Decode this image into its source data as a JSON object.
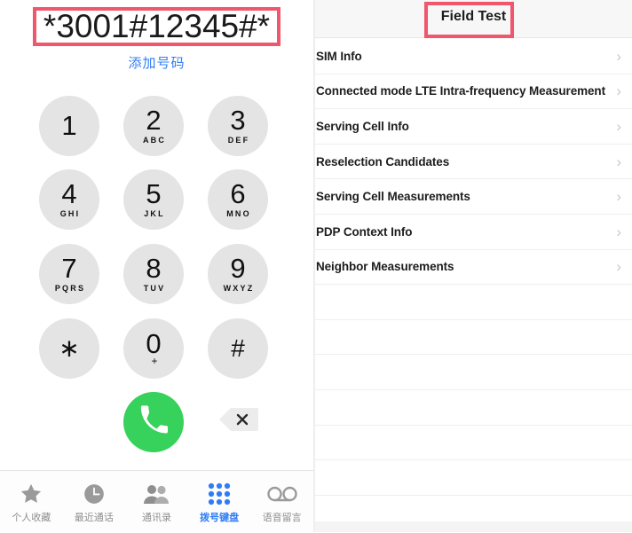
{
  "dialer": {
    "number": "*3001#12345#*",
    "add_number_label": "添加号码",
    "keys": [
      {
        "digit": "1",
        "letters": ""
      },
      {
        "digit": "2",
        "letters": "ABC"
      },
      {
        "digit": "3",
        "letters": "DEF"
      },
      {
        "digit": "4",
        "letters": "GHI"
      },
      {
        "digit": "5",
        "letters": "JKL"
      },
      {
        "digit": "6",
        "letters": "MNO"
      },
      {
        "digit": "7",
        "letters": "PQRS"
      },
      {
        "digit": "8",
        "letters": "TUV"
      },
      {
        "digit": "9",
        "letters": "WXYZ"
      },
      {
        "digit": "∗",
        "letters": ""
      },
      {
        "digit": "0",
        "letters": "+"
      },
      {
        "digit": "#",
        "letters": ""
      }
    ],
    "call_button_icon": "phone-icon",
    "backspace_icon": "backspace-icon",
    "highlight_color": "#f0576d",
    "call_button_color": "#36d25b",
    "link_color": "#2f7cf6"
  },
  "tab_bar": {
    "items": [
      {
        "label": "个人收藏",
        "icon": "star-icon",
        "active": false
      },
      {
        "label": "最近通话",
        "icon": "clock-icon",
        "active": false
      },
      {
        "label": "通讯录",
        "icon": "contacts-icon",
        "active": false
      },
      {
        "label": "拨号键盘",
        "icon": "keypad-icon",
        "active": true
      },
      {
        "label": "语音留言",
        "icon": "voicemail-icon",
        "active": false
      }
    ],
    "active_color": "#2f7cf6",
    "inactive_color": "#8d8d8d"
  },
  "field_test": {
    "title": "Field Test",
    "title_highlight_color": "#f0576d",
    "chevron": "›",
    "items": [
      {
        "label": "SIM Info"
      },
      {
        "label": "Connected mode LTE Intra-frequency Measurement"
      },
      {
        "label": "Serving Cell Info"
      },
      {
        "label": "Reselection Candidates"
      },
      {
        "label": "Serving Cell Measurements"
      },
      {
        "label": "PDP Context Info"
      },
      {
        "label": "Neighbor Measurements"
      }
    ],
    "empty_row_count": 7
  }
}
